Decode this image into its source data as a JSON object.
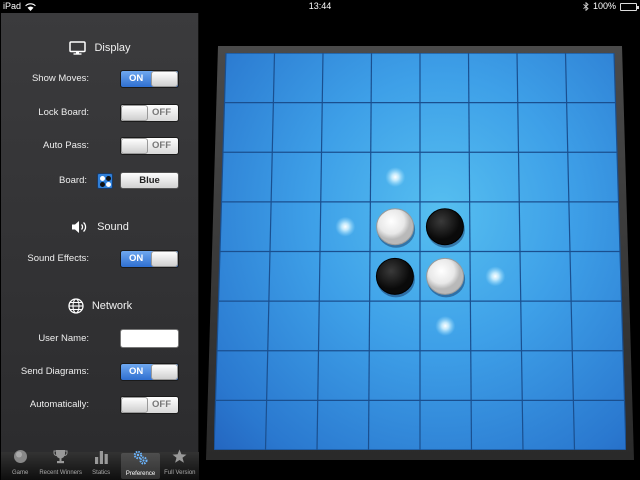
{
  "status_bar": {
    "device": "iPad",
    "time": "13:44",
    "battery": "100%"
  },
  "settings": {
    "display": {
      "header": "Display",
      "show_moves": {
        "label": "Show Moves:",
        "state": "ON"
      },
      "lock_board": {
        "label": "Lock Board:",
        "state": "OFF"
      },
      "auto_pass": {
        "label": "Auto Pass:",
        "state": "OFF"
      },
      "board": {
        "label": "Board:",
        "value": "Blue"
      }
    },
    "sound": {
      "header": "Sound",
      "sound_effects": {
        "label": "Sound Effects:",
        "state": "ON"
      }
    },
    "network": {
      "header": "Network",
      "user_name": {
        "label": "User Name:",
        "value": ""
      },
      "send_diagrams": {
        "label": "Send Diagrams:",
        "state": "ON"
      },
      "automatically": {
        "label": "Automatically:",
        "state": "OFF"
      }
    }
  },
  "tabs": [
    {
      "label": "Game",
      "icon": "disc-icon",
      "selected": false
    },
    {
      "label": "Recent Winners",
      "icon": "trophy-icon",
      "selected": false
    },
    {
      "label": "Statics",
      "icon": "bar-chart-icon",
      "selected": false
    },
    {
      "label": "Preference",
      "icon": "gears-icon",
      "selected": true
    },
    {
      "label": "Full Version",
      "icon": "star-icon",
      "selected": false
    }
  ],
  "board": {
    "size": 8,
    "color": "#3ea0e8",
    "pieces": [
      {
        "row": 3,
        "col": 3,
        "color": "white"
      },
      {
        "row": 3,
        "col": 4,
        "color": "black"
      },
      {
        "row": 4,
        "col": 3,
        "color": "black"
      },
      {
        "row": 4,
        "col": 4,
        "color": "white"
      }
    ],
    "move_hints": [
      {
        "row": 2,
        "col": 3
      },
      {
        "row": 3,
        "col": 2
      },
      {
        "row": 4,
        "col": 5
      },
      {
        "row": 5,
        "col": 4
      }
    ]
  },
  "colors": {
    "toggle_on": "#2f6fd0",
    "panel_bg": "#333335",
    "board_blue": "#3ea0e8"
  }
}
